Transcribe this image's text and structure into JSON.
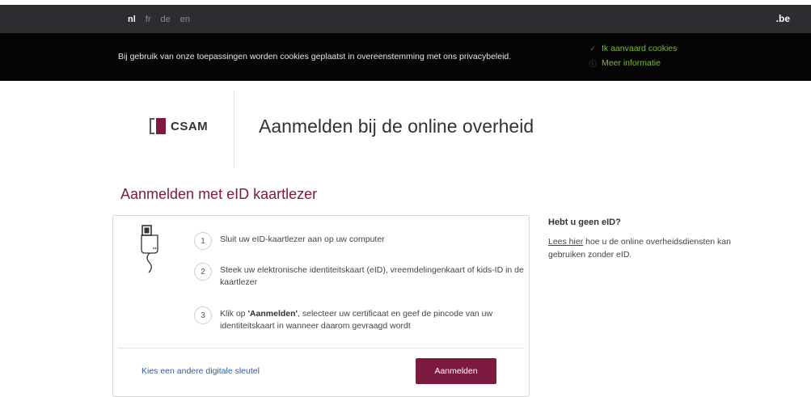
{
  "languages": {
    "nl": "nl",
    "fr": "fr",
    "de": "de",
    "en": "en"
  },
  "domain_label": ".be",
  "cookies": {
    "notice": "Bij gebruik van onze toepassingen worden cookies geplaatst in overeenstemming met ons privacybeleid.",
    "accept": "Ik aanvaard cookies",
    "more_info": "Meer informatie",
    "accent_color": "#7bbf2a"
  },
  "header": {
    "logo_text": "CSAM",
    "title": "Aanmelden bij de online overheid"
  },
  "main": {
    "section_title": "Aanmelden met eID kaartlezer",
    "steps": [
      {
        "num": "1",
        "text": "Sluit uw eID-kaartlezer aan op uw computer"
      },
      {
        "num": "2",
        "text": "Steek uw elektronische identiteitskaart (eID), vreemdelingenkaart of kids-ID in de kaartlezer"
      },
      {
        "num": "3",
        "prefix": "Klik op ",
        "bold": "'Aanmelden'",
        "suffix": ", selecteer uw certificaat en geef de pincode van uw identiteitskaart in wanneer daarom gevraagd wordt"
      }
    ],
    "alt_key_link": "Kies een andere digitale sleutel",
    "login_button": "Aanmelden"
  },
  "sidebar": {
    "title": "Hebt u geen eID?",
    "link": "Lees hier",
    "text": " hoe u de online overheidsdiensten kan gebruiken zonder eID."
  },
  "colors": {
    "brand": "#7c1a3f",
    "link": "#2a5da8",
    "topbar": "#2b2d30",
    "cookiebar": "#050505"
  },
  "icons": {
    "card_reader": "card-reader-icon",
    "accept": "check-icon",
    "info": "info-icon"
  }
}
